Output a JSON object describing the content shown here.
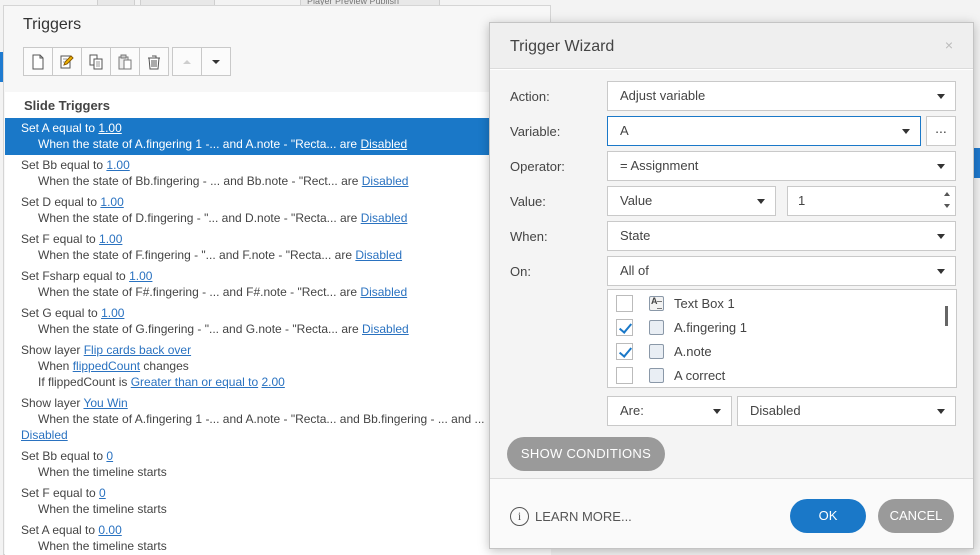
{
  "background": {
    "tabs": [
      "",
      "",
      "Player  Preview  Publish"
    ]
  },
  "triggers_panel": {
    "title": "Triggers",
    "section_title": "Slide Triggers",
    "toolbar": [
      {
        "icon": "new-trigger-icon",
        "enabled": true
      },
      {
        "icon": "edit-trigger-icon",
        "enabled": true
      },
      {
        "icon": "copy-icon",
        "enabled": true
      },
      {
        "icon": "paste-icon",
        "enabled": true
      },
      {
        "icon": "delete-icon",
        "enabled": true
      },
      {
        "icon": "move-up-icon",
        "enabled": false
      },
      {
        "icon": "move-down-icon",
        "enabled": true
      }
    ],
    "triggers": [
      {
        "l1a": "Set A equal to ",
        "l1link": "1.00",
        "l2a": "When the state of A.fingering 1 -... and A.note - \"Recta... are ",
        "l2link": "Disabled",
        "selected": true
      },
      {
        "l1a": "Set Bb equal to ",
        "l1link": "1.00",
        "l2a": "When the state of Bb.fingering - ... and Bb.note - \"Rect... are ",
        "l2link": "Disabled"
      },
      {
        "l1a": "Set D equal to ",
        "l1link": "1.00",
        "l2a": "When the state of D.fingering - \"... and D.note - \"Recta... are ",
        "l2link": "Disabled"
      },
      {
        "l1a": "Set F equal to ",
        "l1link": "1.00",
        "l2a": "When the state of F.fingering - \"... and F.note - \"Recta... are ",
        "l2link": "Disabled"
      },
      {
        "l1a": "Set Fsharp equal to ",
        "l1link": "1.00",
        "l2a": "When the state of F#.fingering - ... and F#.note - \"Rect... are ",
        "l2link": "Disabled"
      },
      {
        "l1a": "Set G equal to ",
        "l1link": "1.00",
        "l2a": "When the state of G.fingering - \"... and G.note - \"Recta... are ",
        "l2link": "Disabled"
      }
    ],
    "show_layer_1": {
      "l1a": "Show layer ",
      "l1link": "Flip cards back over",
      "l2a": "When ",
      "l2link": "flippedCount",
      "l2b": " changes",
      "l3a": "If flippedCount is ",
      "l3link": "Greater than or equal to",
      "l3b": " ",
      "l3link2": "2.00"
    },
    "show_layer_2": {
      "l1a": "Show layer ",
      "l1link": "You Win",
      "l2a": "When the state of A.fingering 1 -... and A.note - \"Recta... and Bb.fingering - ... and ...",
      "l3link": "Disabled"
    },
    "timeline_triggers": [
      {
        "l1a": "Set Bb equal to ",
        "l1link": "0",
        "l2": "When the timeline starts"
      },
      {
        "l1a": "Set F equal to ",
        "l1link": "0",
        "l2": "When the timeline starts"
      },
      {
        "l1a": "Set A equal to ",
        "l1link": "0.00",
        "l2": "When the timeline starts"
      }
    ]
  },
  "wizard": {
    "title": "Trigger Wizard",
    "close": "×",
    "labels": {
      "action": "Action:",
      "variable": "Variable:",
      "operator": "Operator:",
      "value": "Value:",
      "when": "When:",
      "on": "On:"
    },
    "action_value": "Adjust variable",
    "variable_value": "A",
    "ellipsis": "...",
    "operator_value": "= Assignment",
    "value_type": "Value",
    "value_number": "1",
    "when_value": "State",
    "on_value": "All of",
    "objects": [
      {
        "label": "Text Box 1",
        "checked": false,
        "icon": "textbox-icon"
      },
      {
        "label": "A.fingering 1",
        "checked": true,
        "icon": "shape-icon"
      },
      {
        "label": "A.note",
        "checked": true,
        "icon": "shape-icon"
      },
      {
        "label": "A correct",
        "checked": false,
        "icon": "shape-icon"
      }
    ],
    "are_label": "Are:",
    "state_value": "Disabled",
    "show_conditions": "SHOW CONDITIONS",
    "learn_more": "LEARN MORE...",
    "ok": "OK",
    "cancel": "CANCEL"
  },
  "colors": {
    "accent": "#1a78c8",
    "selected_row": "#1a78c8",
    "link": "#2a72c0",
    "secondary_button": "#9a9a9a"
  }
}
